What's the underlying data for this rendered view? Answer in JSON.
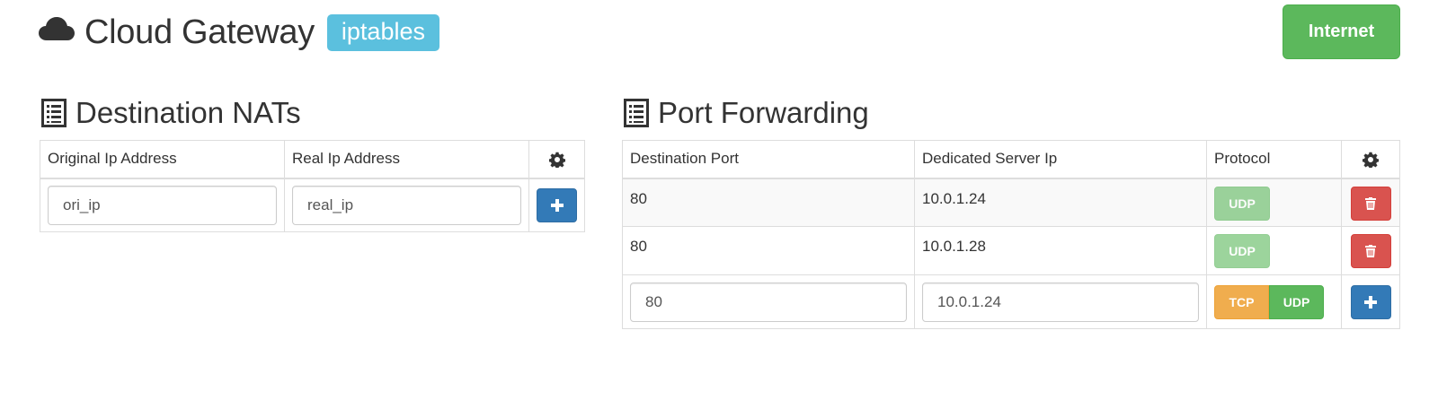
{
  "header": {
    "title": "Cloud Gateway",
    "label": "iptables",
    "internet_button": "Internet",
    "icon": "cloud-icon"
  },
  "nat": {
    "title": "Destination NATs",
    "columns": [
      "Original Ip Address",
      "Real Ip Address"
    ],
    "settings_icon": "gear-icon",
    "inputs": {
      "original_ip": "ori_ip",
      "real_ip": "real_ip"
    },
    "add_icon": "plus-icon"
  },
  "port_forwarding": {
    "title": "Port Forwarding",
    "columns": [
      "Destination Port",
      "Dedicated Server Ip",
      "Protocol"
    ],
    "rows": [
      {
        "port": "80",
        "server_ip": "10.0.1.24",
        "protocol": "UDP"
      },
      {
        "port": "80",
        "server_ip": "10.0.1.28",
        "protocol": "UDP"
      }
    ],
    "inputs": {
      "port": "80",
      "server_ip": "10.0.1.24"
    },
    "protocol_options": [
      "TCP",
      "UDP"
    ],
    "delete_icon": "trash-icon",
    "add_icon": "plus-icon"
  },
  "colors": {
    "primary": "#337ab7",
    "success": "#5cb85c",
    "info": "#5bc0de",
    "warning": "#f0ad4e",
    "danger": "#d9534f"
  }
}
